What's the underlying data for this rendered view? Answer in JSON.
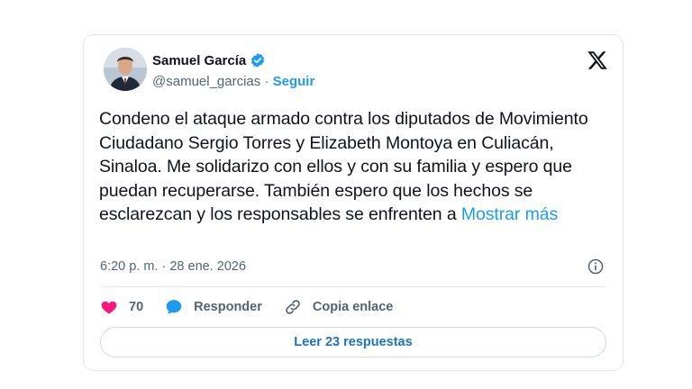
{
  "author": {
    "name": "Samuel García",
    "handle": "@samuel_garcias",
    "separator": " · ",
    "follow_label": "Seguir"
  },
  "tweet": {
    "text": "Condeno el ataque armado contra los diputados de Movimiento Ciudadano Sergio Torres y Elizabeth Montoya en Culiacán, Sinaloa. Me solidarizo con ellos y con su familia y espero que puedan recuperarse. También espero que los hechos se esclarezcan y los responsables se enfrenten a ",
    "show_more_label": "Mostrar más",
    "timestamp": "6:20 p. m. · 28 ene. 2026"
  },
  "actions": {
    "like_count": "70",
    "reply_label": "Responder",
    "copy_link_label": "Copia enlace"
  },
  "read_replies_label": "Leer 23 respuestas",
  "colors": {
    "accent": "#1d9bf0",
    "like": "#f91880",
    "text": "#0f1419",
    "secondary": "#536471"
  },
  "icons": [
    "verified-badge-icon",
    "x-logo-icon",
    "info-icon",
    "heart-icon",
    "reply-bubble-icon",
    "link-icon"
  ]
}
